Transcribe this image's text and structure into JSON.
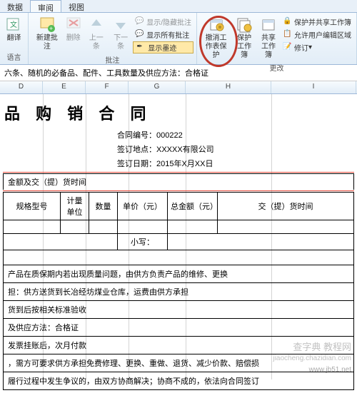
{
  "tabs": {
    "t1": "数据",
    "t2": "审阅",
    "t3": "视图"
  },
  "ribbon": {
    "translate": "翻译",
    "new_comment": "新建批注",
    "delete": "删除",
    "prev": "上一条",
    "next": "下一条",
    "show_hide": "显示/隐藏批注",
    "show_all": "显示所有批注",
    "show_ink": "显示墨迹",
    "unprotect_sheet": "撤消工作表保护",
    "protect_wb": "保护工作簿",
    "share_wb": "共享工作簿",
    "protect_share": "保护并共享工作簿",
    "allow_edit": "允许用户编辑区域",
    "track": "修订",
    "grp_lang": "语言",
    "grp_comment": "批注",
    "grp_changes": "更改"
  },
  "context_line": "六条、随机的必备品、配件、工具数量及供应方法：合格证",
  "cols": {
    "D": "D",
    "E": "E",
    "F": "F",
    "G": "G",
    "H": "H",
    "I": "I"
  },
  "doc": {
    "title": "品 购 销 合 同",
    "m1_label": "合同编号：",
    "m1_val": "000222",
    "m2_label": "签订地点：",
    "m2_val": "XXXXX有限公司",
    "m3_label": "签订日期：",
    "m3_val": "2015年X月XX日",
    "sec1": "金额及交（提）货时间",
    "h1": "规格型号",
    "h2": "计量单位",
    "h3": "数量",
    "h4": "单价（元）",
    "h5": "总金额（元）",
    "h6": "交（提）货时间",
    "small": "小写：",
    "line_a": "产品在质保期内若出现质量问题，由供方负责产品的维修、更换",
    "line_b": "担：供方送货到长冶经坊煤业仓库，运费由供方承担",
    "line_c": "货到后按相关标准验收",
    "line_d": "及供应方法：合格证",
    "line_e": "发票挂账后，次月付款",
    "line_f": "，需方可要求供方承担免费修理、更换、重做、退货、减少价款、赔偿损",
    "line_g": "履行过程中发生争议的，由双方协商解决；协商不成的，依法向合同签订"
  },
  "watermark": {
    "a": "查字典 教程网",
    "b": "jiaocheng.chazidian.com",
    "c": "www.jb51.net"
  }
}
